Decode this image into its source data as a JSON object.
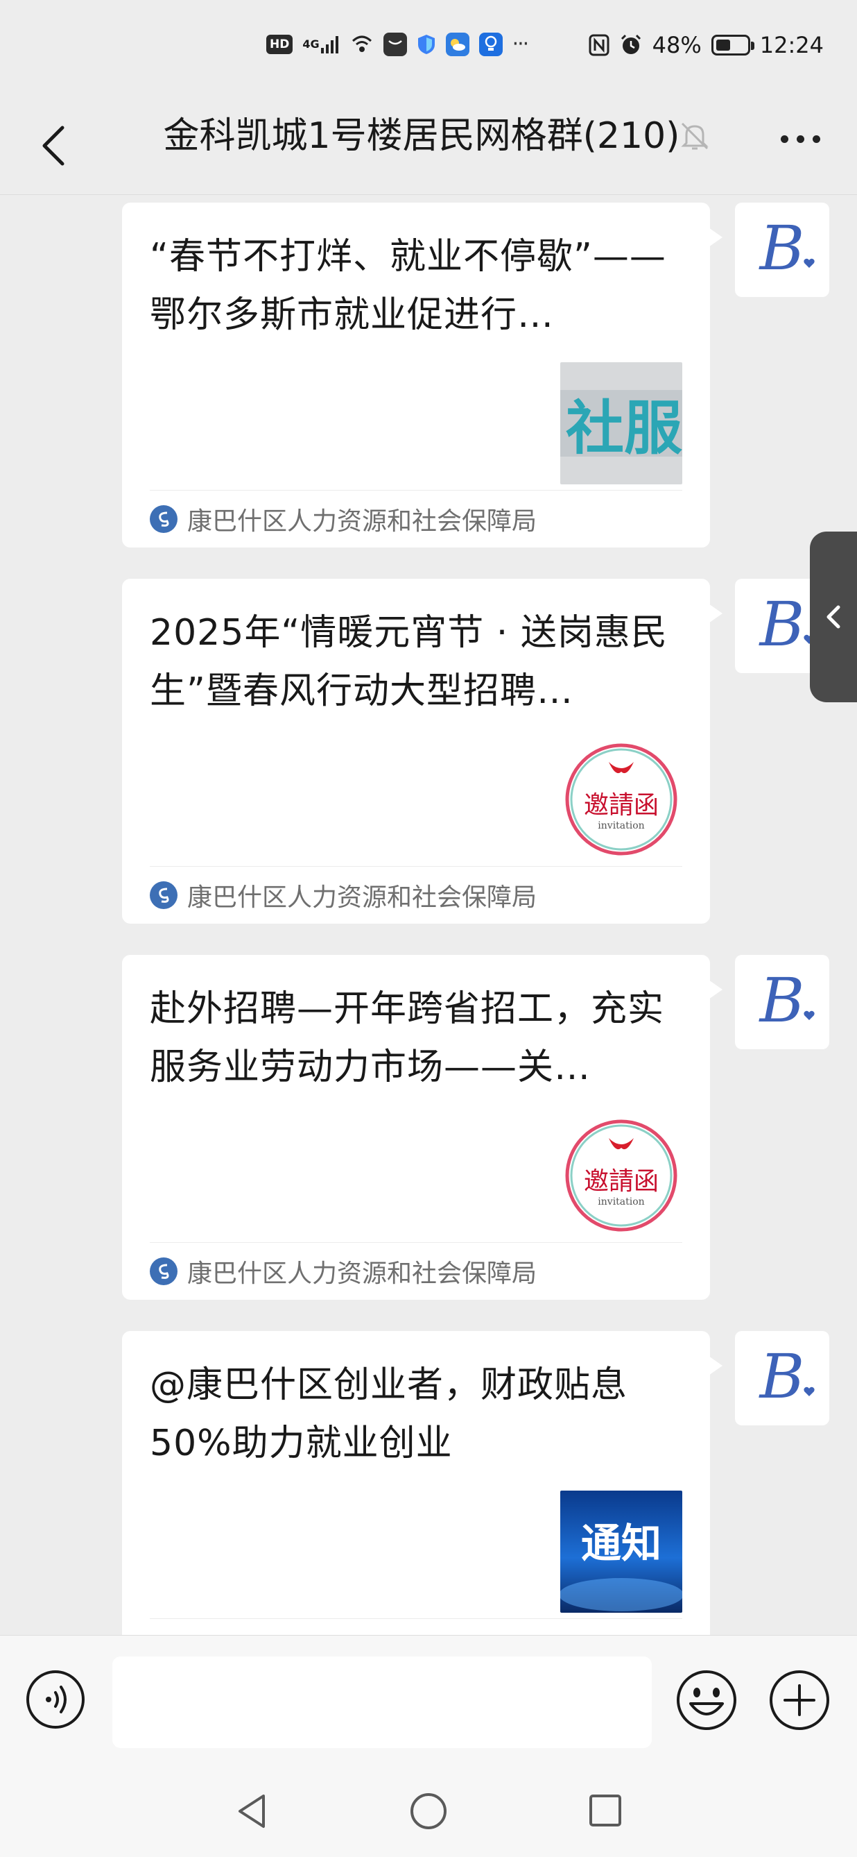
{
  "status_bar": {
    "hd": "HD",
    "network": "4G",
    "battery_percent": "48%",
    "battery_level": 0.48,
    "time": "12:24",
    "more_indicator": "···"
  },
  "header": {
    "title": "金科凯城1号楼居民网格群(210)",
    "back_icon": "chevron-left-icon",
    "mute_icon": "bell-off-icon",
    "more_icon": "ellipsis-icon"
  },
  "messages": [
    {
      "title": "“春节不打烊、就业不停歇”——鄂尔多斯市就业促进行…",
      "source": "康巴什区人力资源和社会保障局",
      "thumb": "社服"
    },
    {
      "title": "2025年“情暖元宵节 · 送岗惠民生”暨春风行动大型招聘…",
      "source": "康巴什区人力资源和社会保障局",
      "thumb": "邀請函"
    },
    {
      "title": "赴外招聘—开年跨省招工，充实服务业劳动力市场——关…",
      "source": "康巴什区人力资源和社会保障局",
      "thumb": "邀請函"
    },
    {
      "title": "@康巴什区创业者，财政贴息50%助力就业创业",
      "source": "",
      "thumb": "通知"
    }
  ],
  "thumb_sub_text": "invitation",
  "avatar": {
    "letter": "B",
    "color": "#3d62b8"
  },
  "input": {
    "placeholder": ""
  },
  "colors": {
    "background": "#ededed",
    "card": "#ffffff",
    "source_text": "#6f6f6f"
  }
}
